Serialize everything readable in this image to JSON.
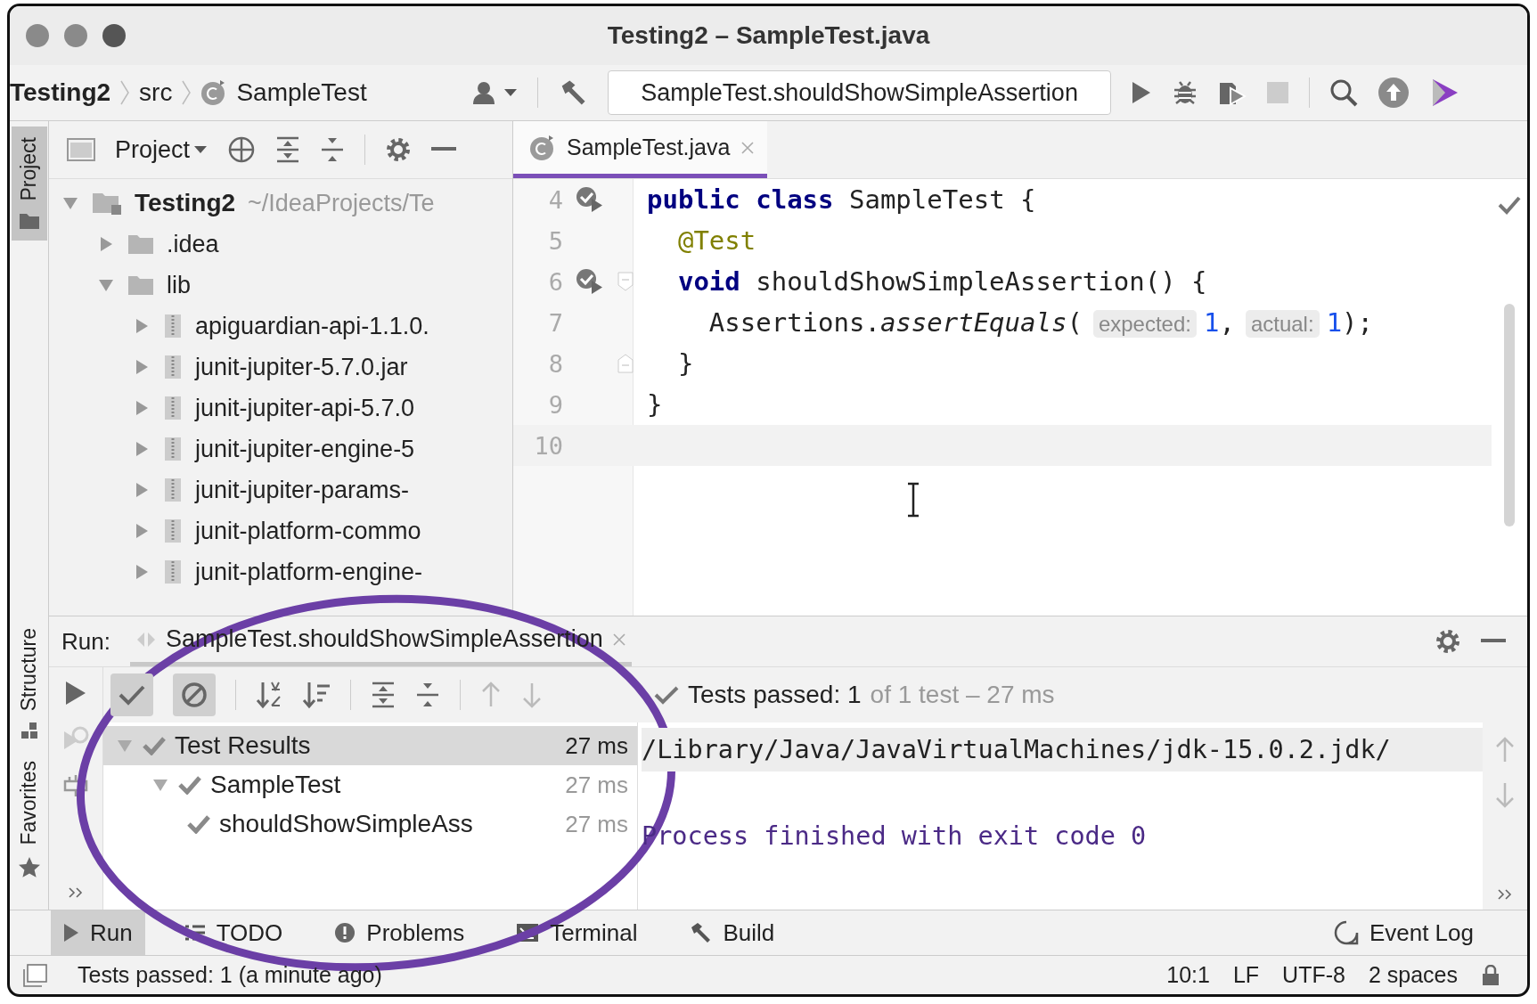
{
  "window": {
    "title": "Testing2 – SampleTest.java"
  },
  "navbar": {
    "breadcrumbs": [
      {
        "text": "Testing2",
        "kind": "project"
      },
      {
        "text": "src",
        "kind": "folder"
      },
      {
        "text": "SampleTest",
        "kind": "class"
      }
    ],
    "run_config": "SampleTest.shouldShowSimpleAssertion"
  },
  "tool_stripe": [
    {
      "label": "Project",
      "kind": "project",
      "selected": true
    },
    {
      "label": "Structure",
      "kind": "structure",
      "selected": false
    },
    {
      "label": "Favorites",
      "kind": "favorites",
      "selected": false
    }
  ],
  "project_panel": {
    "title": "Project",
    "tree": [
      {
        "name": "Testing2",
        "path": "~/IdeaProjects/Te",
        "kind": "module",
        "expanded": true,
        "children": [
          {
            "name": ".idea",
            "kind": "folder",
            "expanded": false
          },
          {
            "name": "lib",
            "kind": "folder",
            "expanded": true,
            "children": [
              {
                "name": "apiguardian-api-1.1.0.",
                "kind": "jar",
                "expanded": false
              },
              {
                "name": "junit-jupiter-5.7.0.jar",
                "kind": "jar",
                "expanded": false
              },
              {
                "name": "junit-jupiter-api-5.7.0",
                "kind": "jar",
                "expanded": false
              },
              {
                "name": "junit-jupiter-engine-5",
                "kind": "jar",
                "expanded": false
              },
              {
                "name": "junit-jupiter-params-",
                "kind": "jar",
                "expanded": false
              },
              {
                "name": "junit-platform-commo",
                "kind": "jar",
                "expanded": false
              },
              {
                "name": "junit-platform-engine-",
                "kind": "jar",
                "expanded": false
              }
            ]
          }
        ]
      }
    ]
  },
  "editor": {
    "tab": {
      "label": "SampleTest.java",
      "selected": true
    },
    "lines": [
      {
        "number": "4",
        "runnable": true,
        "fold_start": false,
        "fold_end": false,
        "tokens": [
          {
            "kind": "keyword",
            "text": "public "
          },
          {
            "kind": "keyword",
            "text": "class"
          },
          {
            "kind": "plain",
            "text": " SampleTest {"
          }
        ]
      },
      {
        "number": "5",
        "runnable": false,
        "fold_start": false,
        "fold_end": false,
        "tokens": [
          {
            "kind": "annotation",
            "text": "  @Test"
          }
        ]
      },
      {
        "number": "6",
        "runnable": true,
        "fold_start": true,
        "fold_end": false,
        "tokens": [
          {
            "kind": "keyword",
            "text": "  void"
          },
          {
            "kind": "plain",
            "text": " shouldShowSimpleAssertion() {"
          }
        ]
      },
      {
        "number": "7",
        "runnable": false,
        "fold_start": false,
        "fold_end": false,
        "tokens": [
          {
            "kind": "plain",
            "text": "    Assertions."
          },
          {
            "kind": "method",
            "text": "assertEquals"
          },
          {
            "kind": "plain",
            "text": "("
          },
          {
            "kind": "hint",
            "text": "expected:"
          },
          {
            "kind": "number",
            "text": "1"
          },
          {
            "kind": "plain",
            "text": ","
          },
          {
            "kind": "hint",
            "text": "actual:"
          },
          {
            "kind": "number",
            "text": "1"
          },
          {
            "kind": "plain",
            "text": ");"
          }
        ]
      },
      {
        "number": "8",
        "runnable": false,
        "fold_start": false,
        "fold_end": true,
        "tokens": [
          {
            "kind": "plain",
            "text": "  }"
          }
        ]
      },
      {
        "number": "9",
        "runnable": false,
        "fold_start": false,
        "fold_end": false,
        "tokens": [
          {
            "kind": "plain",
            "text": "}"
          }
        ]
      },
      {
        "number": "10",
        "runnable": false,
        "fold_start": false,
        "fold_end": false,
        "current": true
      }
    ]
  },
  "run_panel": {
    "label": "Run:",
    "tab": "SampleTest.shouldShowSimpleAssertion",
    "toggles": [
      {
        "kind": "passed",
        "on": true
      },
      {
        "kind": "ignored",
        "on": true
      }
    ],
    "summary": {
      "passed": "Tests passed: 1",
      "detail": "of 1 test – 27 ms"
    },
    "tests": [
      {
        "name": "Test Results",
        "time": "27 ms",
        "selected": true,
        "expanded": true,
        "children": [
          {
            "name": "SampleTest",
            "time": "27 ms",
            "selected": false,
            "expanded": true,
            "children": [
              {
                "name": "shouldShowSimpleAss",
                "time": "27 ms",
                "selected": false
              }
            ]
          }
        ]
      }
    ],
    "console": [
      {
        "text": "/Library/Java/JavaVirtualMachines/jdk-15.0.2.jdk/",
        "kind": "command"
      },
      {
        "text": "Process finished with exit code 0",
        "kind": "exit"
      }
    ]
  },
  "bottom_tabs": [
    {
      "label": "Run",
      "kind": "run",
      "selected": true
    },
    {
      "label": "TODO",
      "kind": "todo",
      "selected": false
    },
    {
      "label": "Problems",
      "kind": "problems",
      "selected": false
    },
    {
      "label": "Terminal",
      "kind": "terminal",
      "selected": false
    },
    {
      "label": "Build",
      "kind": "build",
      "selected": false
    }
  ],
  "event_log": "Event Log",
  "status_bar": {
    "message": "Tests passed: 1 (a minute ago)",
    "items": [
      "10:1",
      "LF",
      "UTF-8",
      "2 spaces"
    ]
  }
}
